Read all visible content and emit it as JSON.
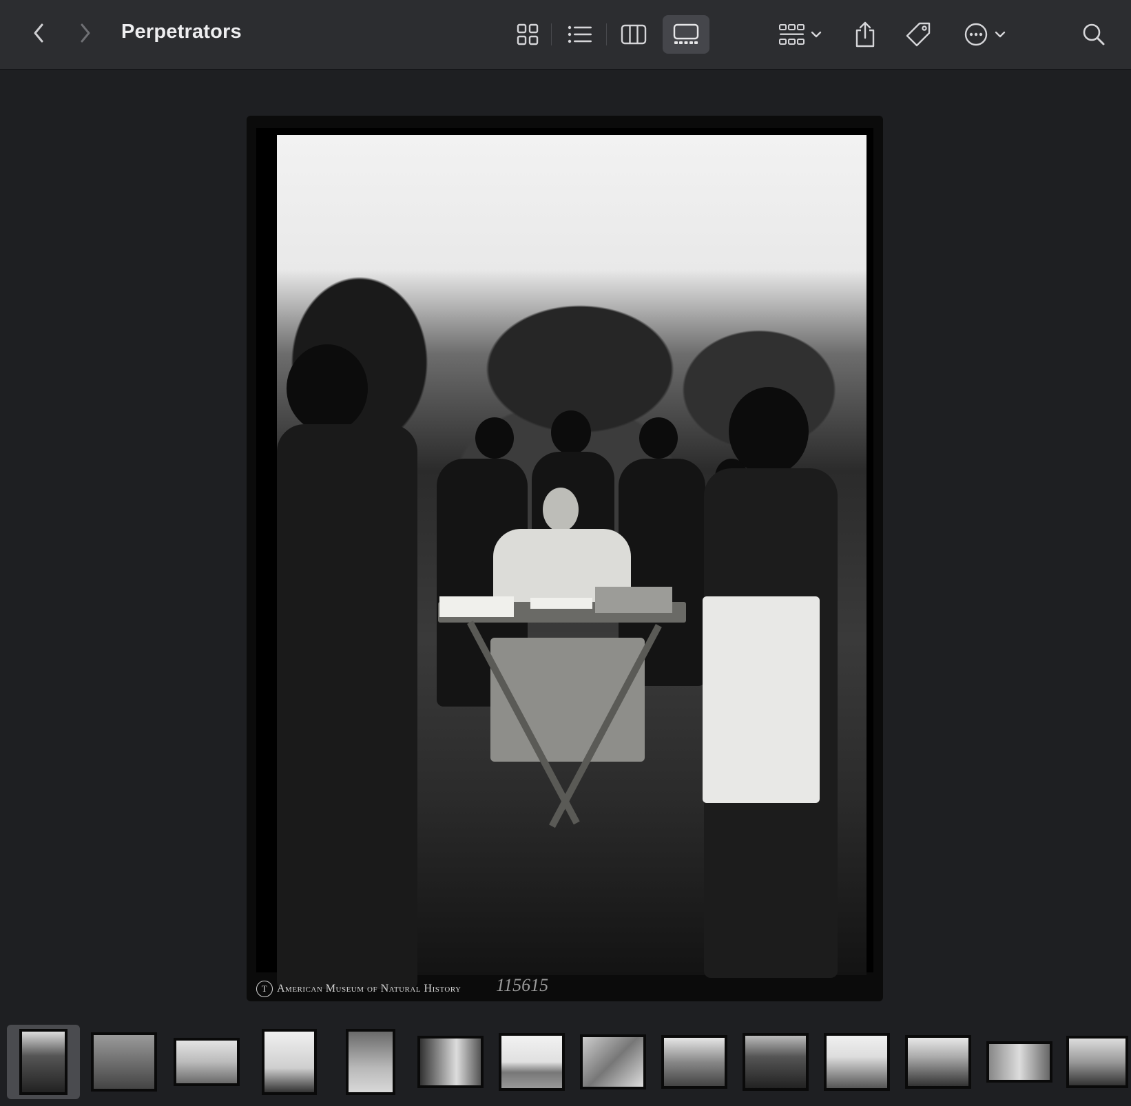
{
  "window": {
    "title": "Perpetrators"
  },
  "toolbar": {
    "back_icon": "chevron-left-icon",
    "forward_icon": "chevron-right-icon",
    "view_modes": [
      "icon-view",
      "list-view",
      "column-view",
      "gallery-view"
    ],
    "active_view": "gallery-view",
    "group_icon": "group-by-icon",
    "share_icon": "share-icon",
    "tag_icon": "tag-icon",
    "more_icon": "more-actions-icon",
    "search_icon": "search-icon"
  },
  "preview": {
    "caption": "American Museum of Natural History",
    "negative_number": "115615"
  },
  "filmstrip": {
    "selected_index": 0,
    "count": 14
  },
  "colors": {
    "toolbar_bg": "#2c2d30",
    "window_bg": "#1e1f22",
    "active_button": "#45464b",
    "selection": "#4a4b4f"
  }
}
